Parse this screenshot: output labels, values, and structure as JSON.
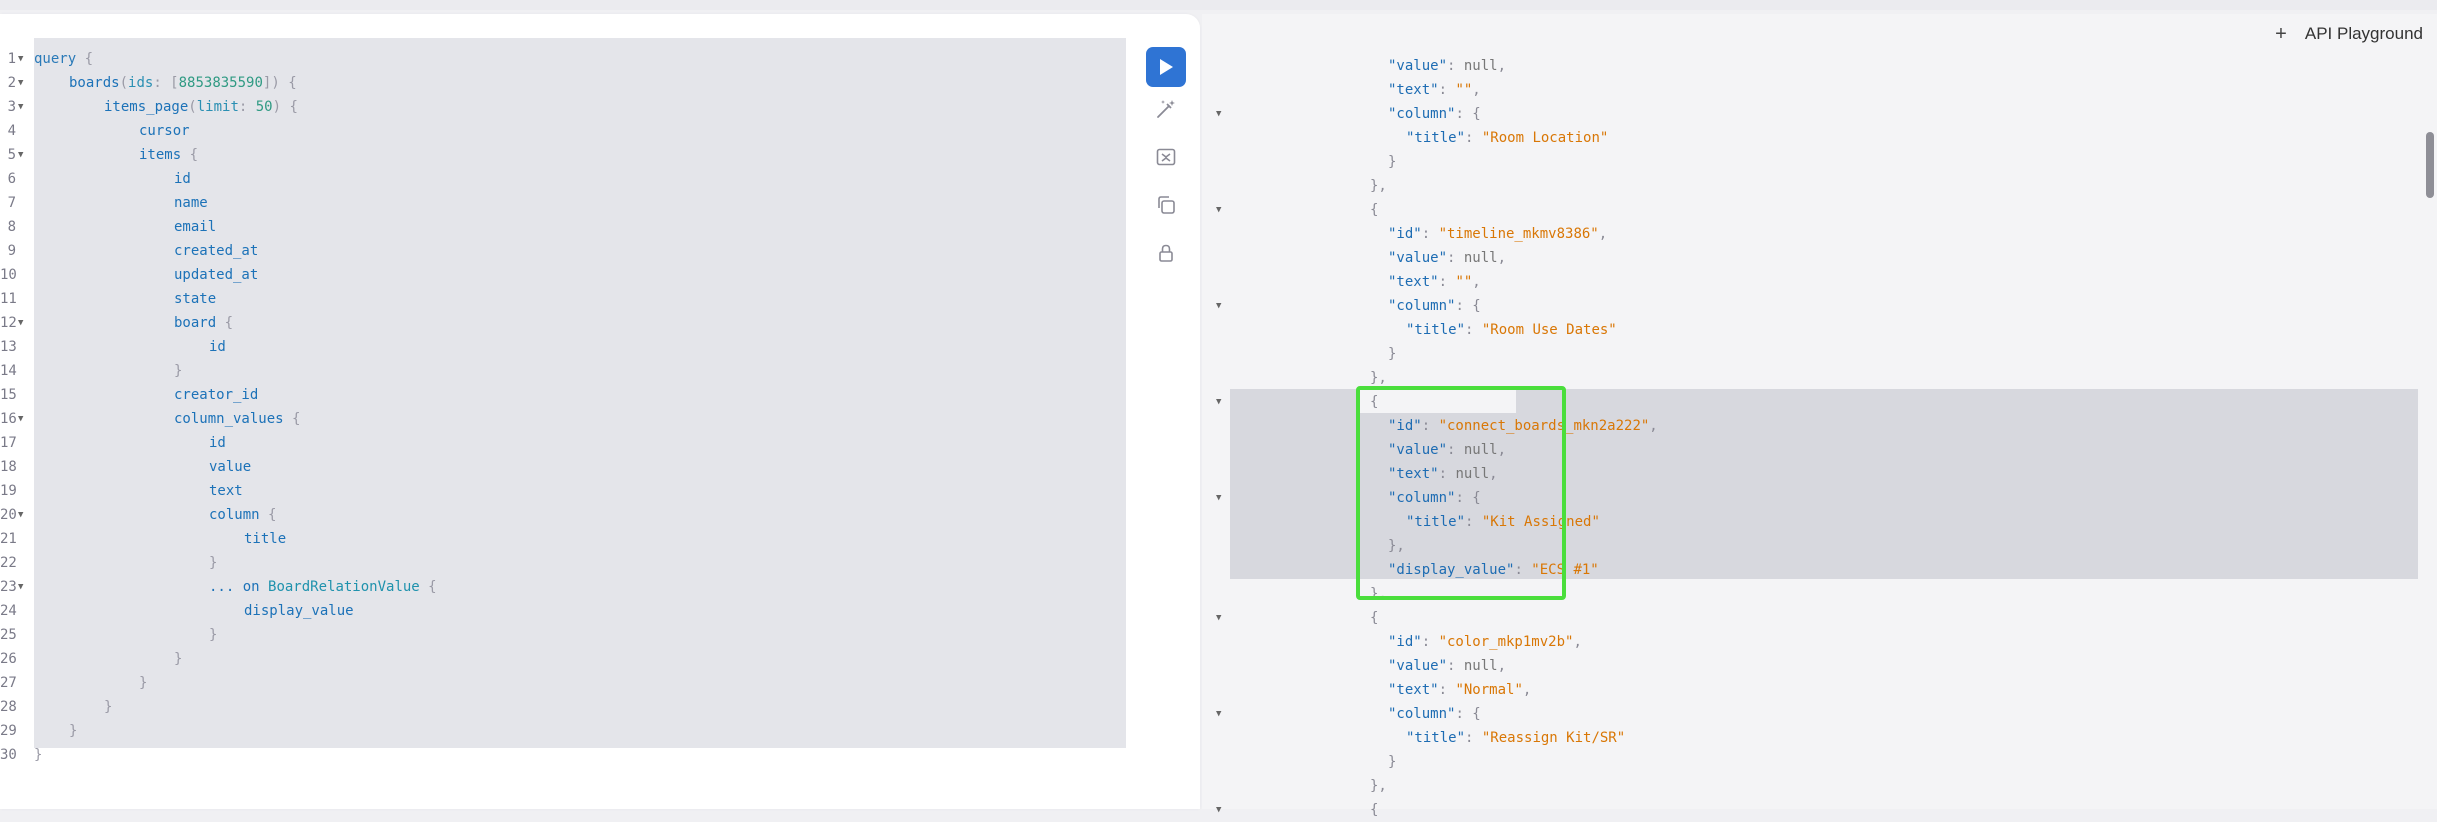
{
  "header": {
    "title": "API Playground",
    "plus": "+"
  },
  "editor": {
    "line_numbers": [
      "1",
      "2",
      "3",
      "4",
      "5",
      "6",
      "7",
      "8",
      "9",
      "10",
      "11",
      "12",
      "13",
      "14",
      "15",
      "16",
      "17",
      "18",
      "19",
      "20",
      "21",
      "22",
      "23",
      "24",
      "25",
      "26",
      "27",
      "28",
      "29",
      "30"
    ],
    "query_keyword": "query",
    "boards_field": "boards",
    "ids_arg": "ids",
    "board_id": "8853835590",
    "items_page_field": "items_page",
    "limit_arg": "limit",
    "limit_value": "50",
    "fields": {
      "cursor": "cursor",
      "items": "items",
      "id": "id",
      "name": "name",
      "email": "email",
      "created_at": "created_at",
      "updated_at": "updated_at",
      "state": "state",
      "board": "board",
      "creator_id": "creator_id",
      "column_values": "column_values",
      "value": "value",
      "text": "text",
      "column": "column",
      "title": "title",
      "on": "... on",
      "fragment_type": "BoardRelationValue",
      "display_value": "display_value"
    }
  },
  "toolbar": {
    "run_icon": "play-icon",
    "prettify_icon": "magic-wand-icon",
    "merge_icon": "merge-fragments-icon",
    "copy_icon": "copy-icon",
    "lock_icon": "lock-icon"
  },
  "results": {
    "k_value": "\"value\"",
    "k_text": "\"text\"",
    "k_column": "\"column\"",
    "k_title": "\"title\"",
    "k_id": "\"id\"",
    "k_display_value": "\"display_value\"",
    "null": "null",
    "empty": "\"\"",
    "room_location": "\"Room Location\"",
    "timeline_id": "\"timeline_mkmv8386\"",
    "room_use_dates": "\"Room Use Dates\"",
    "connect_id": "\"connect_boards_mkn2a222\"",
    "kit_assigned": "\"Kit Assigned\"",
    "ecs": "\"ECS #1\"",
    "color_id": "\"color_mkp1mv2b\"",
    "normal": "\"Normal\"",
    "reassign": "\"Reassign Kit/SR\""
  },
  "colors": {
    "accent": "#2f74d4",
    "highlight_border": "#4ade3c"
  }
}
